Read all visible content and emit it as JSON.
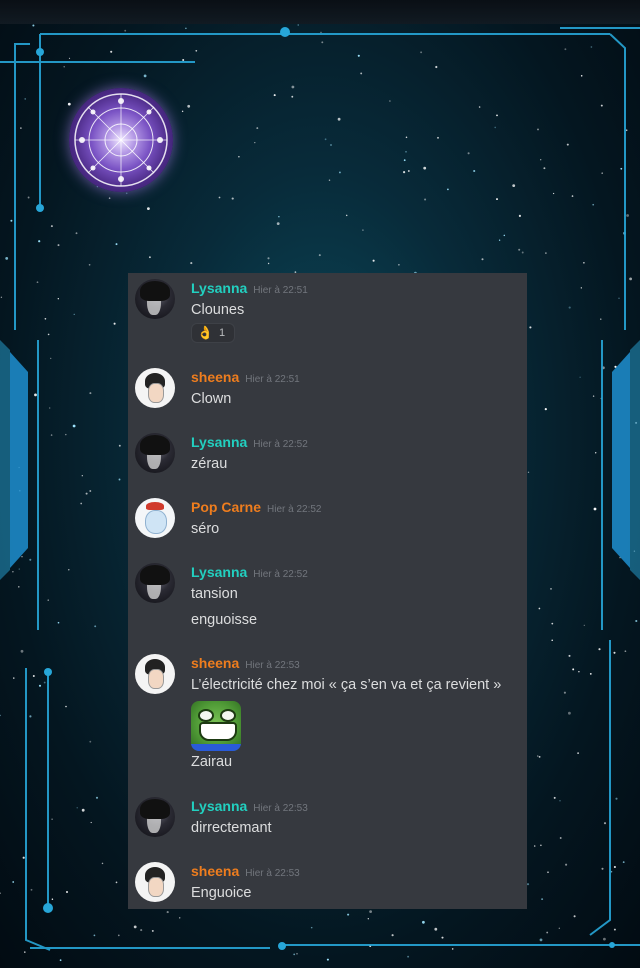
{
  "messages": [
    {
      "author": "Lysanna",
      "timestamp": "Hier à 22:51",
      "lines": [
        "Clounes"
      ],
      "reaction": {
        "emoji": "👌",
        "count": "1"
      }
    },
    {
      "author": "sheena",
      "timestamp": "Hier à 22:51",
      "lines": [
        "Clown"
      ]
    },
    {
      "author": "Lysanna",
      "timestamp": "Hier à 22:52",
      "lines": [
        "zérau"
      ]
    },
    {
      "author": "Pop Carne",
      "timestamp": "Hier à 22:52",
      "lines": [
        "séro"
      ]
    },
    {
      "author": "Lysanna",
      "timestamp": "Hier à 22:52",
      "lines": [
        "tansion",
        "enguoisse"
      ]
    },
    {
      "author": "sheena",
      "timestamp": "Hier à 22:53",
      "lines": [
        "L’électricité chez moi « ça s’en va et ça revient »",
        "Zairau"
      ],
      "sticker": "pepe-crying-laughing"
    },
    {
      "author": "Lysanna",
      "timestamp": "Hier à 22:53",
      "lines": [
        "dirrectemant"
      ]
    },
    {
      "author": "sheena",
      "timestamp": "Hier à 22:53",
      "lines": [
        "Enguoice"
      ]
    }
  ],
  "colors": {
    "lysanna": "#22d0c0",
    "orange_users": "#ee7d1e",
    "chat_background": "#36393f",
    "hud_accent": "#27a6d8"
  },
  "icons": {
    "zodiac_wheel": "zodiac-wheel-icon",
    "reaction": "ok-hand-emoji"
  }
}
